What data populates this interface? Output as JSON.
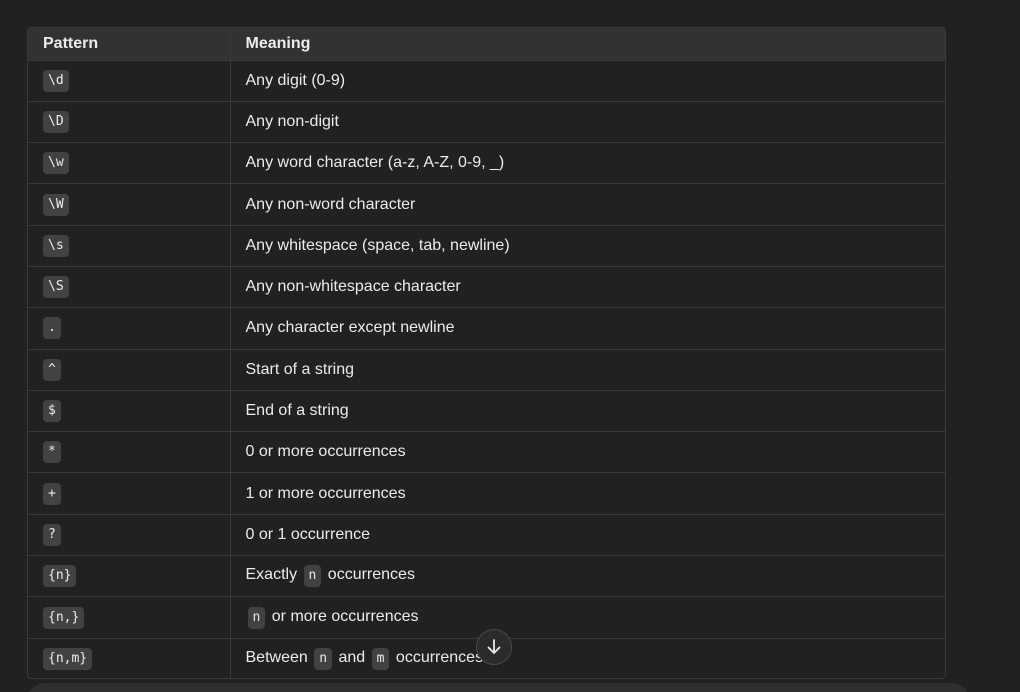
{
  "table": {
    "headers": [
      "Pattern",
      "Meaning"
    ],
    "rows": [
      {
        "pattern": "\\d",
        "meaning": [
          "Any digit (0-9)"
        ]
      },
      {
        "pattern": "\\D",
        "meaning": [
          "Any non-digit"
        ]
      },
      {
        "pattern": "\\w",
        "meaning": [
          "Any word character (a-z, A-Z, 0-9, _)"
        ]
      },
      {
        "pattern": "\\W",
        "meaning": [
          "Any non-word character"
        ]
      },
      {
        "pattern": "\\s",
        "meaning": [
          "Any whitespace (space, tab, newline)"
        ]
      },
      {
        "pattern": "\\S",
        "meaning": [
          "Any non-whitespace character"
        ]
      },
      {
        "pattern": ".",
        "meaning": [
          "Any character except newline"
        ]
      },
      {
        "pattern": "^",
        "meaning": [
          "Start of a string"
        ]
      },
      {
        "pattern": "$",
        "meaning": [
          "End of a string"
        ]
      },
      {
        "pattern": "*",
        "meaning": [
          "0 or more occurrences"
        ]
      },
      {
        "pattern": "+",
        "meaning": [
          "1 or more occurrences"
        ]
      },
      {
        "pattern": "?",
        "meaning": [
          "0 or 1 occurrence"
        ]
      },
      {
        "pattern": "{n}",
        "meaning": [
          "Exactly ",
          {
            "code": "n"
          },
          " occurrences"
        ]
      },
      {
        "pattern": "{n,}",
        "meaning": [
          {
            "code": "n"
          },
          " or more occurrences"
        ]
      },
      {
        "pattern": "{n,m}",
        "meaning": [
          "Between ",
          {
            "code": "n"
          },
          " and ",
          {
            "code": "m"
          },
          " occurrences"
        ]
      }
    ]
  },
  "scroll_button": {
    "icon": "arrow-down-icon"
  },
  "colors": {
    "background": "#212121",
    "header_bg": "#323232",
    "border": "#3a3a3a",
    "code_bg": "#424242",
    "text": "#ececec"
  }
}
